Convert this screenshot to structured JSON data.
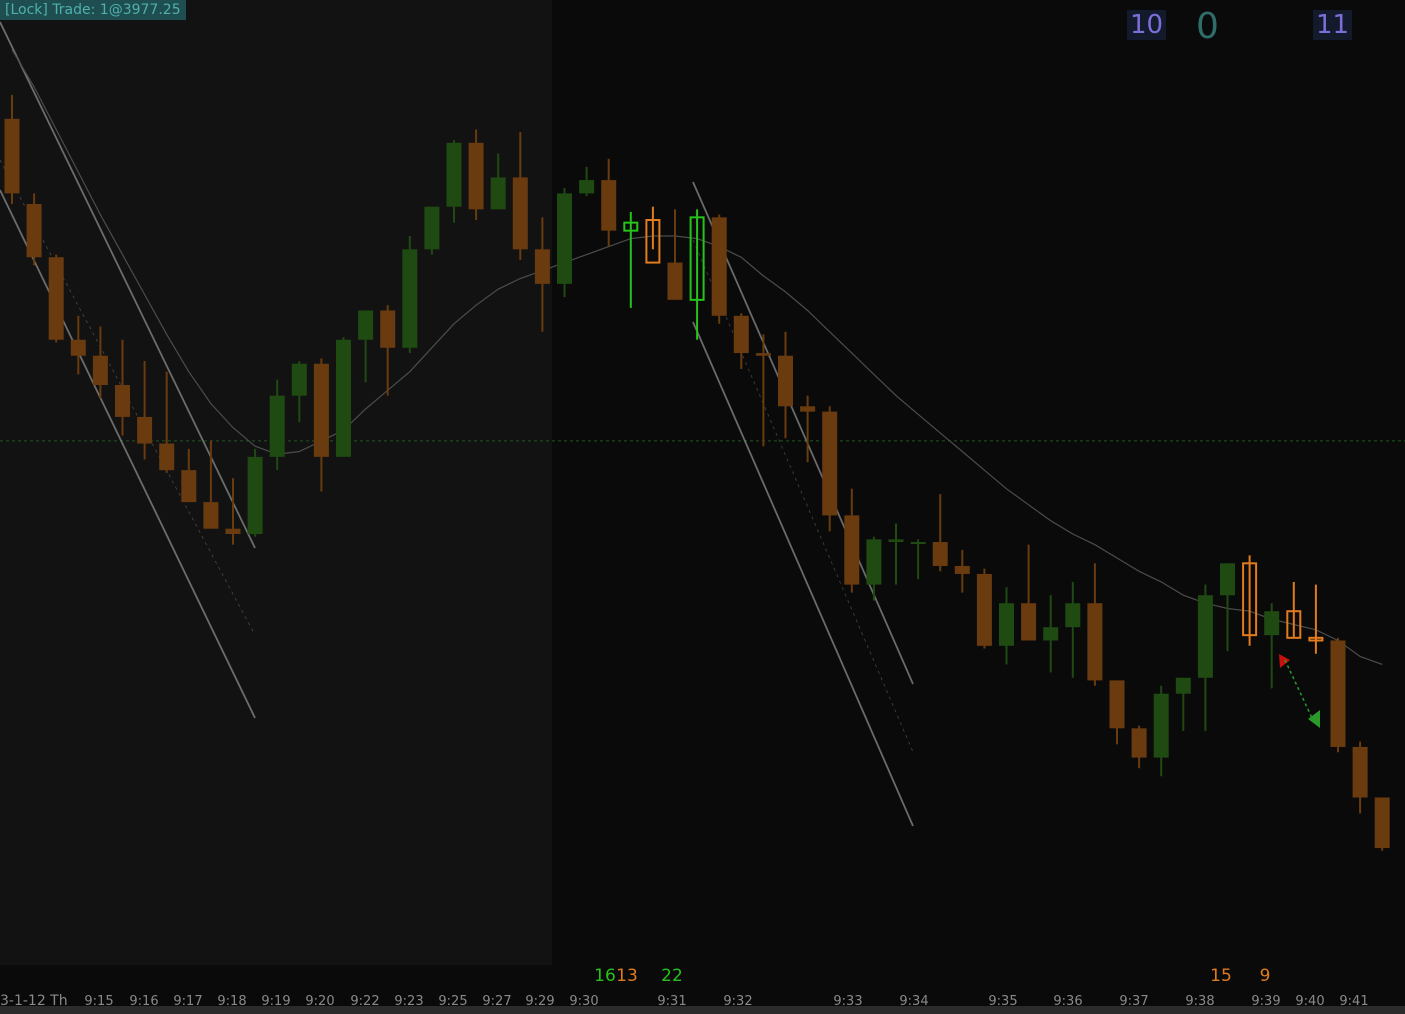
{
  "lock_badge": "[Lock] Trade: 1@3977.25",
  "counters": {
    "left": "10",
    "middle": "0",
    "right": "11"
  },
  "date_label": "3-1-12 Th",
  "colors": {
    "background": "#0a0a0a",
    "shaded_region": "#121212",
    "up_candle": "#1f4a12",
    "down_candle": "#6a3b0f",
    "highlight_down": "#e07b1f",
    "highlight_up": "#27c21a",
    "channel_line": "#8a8a8a",
    "moving_average": "#4c4c4c",
    "price_line": "#1e5a1e"
  },
  "chart_data": {
    "type": "candlestick",
    "title": "",
    "current_price": 3977.25,
    "time_labels": [
      "9:15",
      "9:16",
      "9:17",
      "9:18",
      "9:19",
      "9:20",
      "9:22",
      "9:23",
      "9:25",
      "9:27",
      "9:29",
      "9:30",
      "9:31",
      "9:32",
      "9:33",
      "9:34",
      "9:35",
      "9:36",
      "9:37",
      "9:38",
      "9:39",
      "9:40",
      "9:41"
    ],
    "volume_markers": [
      {
        "label": "16",
        "color": "#27c21a"
      },
      {
        "label": "13",
        "color": "#e07b1f"
      },
      {
        "label": "22",
        "color": "#27c21a"
      },
      {
        "label": "15",
        "color": "#e07b1f"
      },
      {
        "label": "9",
        "color": "#e07b1f"
      }
    ],
    "candles": [
      {
        "o": 3983.3,
        "h": 3983.75,
        "l": 3981.7,
        "c": 3981.9,
        "dir": "down"
      },
      {
        "o": 3981.7,
        "h": 3981.9,
        "l": 3980.55,
        "c": 3980.7,
        "dir": "down"
      },
      {
        "o": 3980.7,
        "h": 3980.75,
        "l": 3979.1,
        "c": 3979.15,
        "dir": "down"
      },
      {
        "o": 3979.15,
        "h": 3979.6,
        "l": 3978.5,
        "c": 3978.85,
        "dir": "down"
      },
      {
        "o": 3978.85,
        "h": 3979.4,
        "l": 3978.05,
        "c": 3978.3,
        "dir": "down"
      },
      {
        "o": 3978.3,
        "h": 3979.15,
        "l": 3977.35,
        "c": 3977.7,
        "dir": "down"
      },
      {
        "o": 3977.7,
        "h": 3978.75,
        "l": 3976.9,
        "c": 3977.2,
        "dir": "down"
      },
      {
        "o": 3977.2,
        "h": 3978.55,
        "l": 3976.65,
        "c": 3976.7,
        "dir": "down"
      },
      {
        "o": 3976.7,
        "h": 3977.1,
        "l": 3976.1,
        "c": 3976.1,
        "dir": "down"
      },
      {
        "o": 3976.1,
        "h": 3977.25,
        "l": 3975.8,
        "c": 3975.6,
        "dir": "down"
      },
      {
        "o": 3975.6,
        "h": 3976.55,
        "l": 3975.3,
        "c": 3975.5,
        "dir": "down"
      },
      {
        "o": 3975.5,
        "h": 3977.1,
        "l": 3975.45,
        "c": 3976.95,
        "dir": "up"
      },
      {
        "o": 3976.95,
        "h": 3978.4,
        "l": 3976.7,
        "c": 3978.1,
        "dir": "up"
      },
      {
        "o": 3978.1,
        "h": 3978.75,
        "l": 3977.6,
        "c": 3978.7,
        "dir": "up"
      },
      {
        "o": 3978.7,
        "h": 3978.8,
        "l": 3976.3,
        "c": 3976.95,
        "dir": "down"
      },
      {
        "o": 3976.95,
        "h": 3979.2,
        "l": 3976.95,
        "c": 3979.15,
        "dir": "up"
      },
      {
        "o": 3979.15,
        "h": 3979.55,
        "l": 3978.35,
        "c": 3979.7,
        "dir": "up"
      },
      {
        "o": 3979.7,
        "h": 3979.8,
        "l": 3978.1,
        "c": 3979.0,
        "dir": "down"
      },
      {
        "o": 3979.0,
        "h": 3981.1,
        "l": 3978.9,
        "c": 3980.85,
        "dir": "up"
      },
      {
        "o": 3980.85,
        "h": 3981.55,
        "l": 3980.75,
        "c": 3981.65,
        "dir": "up"
      },
      {
        "o": 3981.65,
        "h": 3982.9,
        "l": 3981.35,
        "c": 3982.85,
        "dir": "up"
      },
      {
        "o": 3982.85,
        "h": 3983.1,
        "l": 3981.4,
        "c": 3981.6,
        "dir": "down"
      },
      {
        "o": 3981.6,
        "h": 3982.65,
        "l": 3981.85,
        "c": 3982.2,
        "dir": "up"
      },
      {
        "o": 3982.2,
        "h": 3983.05,
        "l": 3980.65,
        "c": 3980.85,
        "dir": "down"
      },
      {
        "o": 3980.85,
        "h": 3981.45,
        "l": 3979.3,
        "c": 3980.2,
        "dir": "down"
      },
      {
        "o": 3980.2,
        "h": 3982.0,
        "l": 3979.95,
        "c": 3981.9,
        "dir": "up"
      },
      {
        "o": 3981.9,
        "h": 3982.4,
        "l": 3981.85,
        "c": 3982.15,
        "dir": "up"
      },
      {
        "o": 3982.15,
        "h": 3982.55,
        "l": 3980.9,
        "c": 3981.2,
        "dir": "down"
      },
      {
        "o": 3981.2,
        "h": 3981.55,
        "l": 3979.75,
        "c": 3981.35,
        "dir": "up",
        "hl": true
      },
      {
        "o": 3981.4,
        "h": 3981.65,
        "l": 3980.85,
        "c": 3980.6,
        "dir": "down",
        "hl": true
      },
      {
        "o": 3980.6,
        "h": 3981.6,
        "l": 3980.05,
        "c": 3979.9,
        "dir": "down"
      },
      {
        "o": 3979.9,
        "h": 3981.6,
        "l": 3979.15,
        "c": 3981.45,
        "dir": "up",
        "hl": true
      },
      {
        "o": 3981.45,
        "h": 3981.5,
        "l": 3979.45,
        "c": 3979.6,
        "dir": "down"
      },
      {
        "o": 3979.6,
        "h": 3979.65,
        "l": 3978.6,
        "c": 3978.9,
        "dir": "down"
      },
      {
        "o": 3978.9,
        "h": 3979.25,
        "l": 3977.15,
        "c": 3978.85,
        "dir": "down"
      },
      {
        "o": 3978.85,
        "h": 3979.3,
        "l": 3977.3,
        "c": 3977.9,
        "dir": "down"
      },
      {
        "o": 3977.9,
        "h": 3978.1,
        "l": 3976.85,
        "c": 3977.8,
        "dir": "down"
      },
      {
        "o": 3977.8,
        "h": 3977.9,
        "l": 3975.55,
        "c": 3975.85,
        "dir": "down"
      },
      {
        "o": 3975.85,
        "h": 3976.35,
        "l": 3974.4,
        "c": 3974.55,
        "dir": "down"
      },
      {
        "o": 3974.55,
        "h": 3975.45,
        "l": 3974.25,
        "c": 3975.4,
        "dir": "up"
      },
      {
        "o": 3975.4,
        "h": 3975.7,
        "l": 3974.55,
        "c": 3975.35,
        "dir": "up"
      },
      {
        "o": 3975.35,
        "h": 3975.4,
        "l": 3974.65,
        "c": 3975.35,
        "dir": "up"
      },
      {
        "o": 3975.35,
        "h": 3976.25,
        "l": 3974.8,
        "c": 3974.9,
        "dir": "down"
      },
      {
        "o": 3974.9,
        "h": 3975.2,
        "l": 3974.4,
        "c": 3974.75,
        "dir": "down"
      },
      {
        "o": 3974.75,
        "h": 3974.85,
        "l": 3973.35,
        "c": 3973.4,
        "dir": "down"
      },
      {
        "o": 3973.4,
        "h": 3974.5,
        "l": 3973.05,
        "c": 3974.2,
        "dir": "up"
      },
      {
        "o": 3974.2,
        "h": 3975.3,
        "l": 3973.65,
        "c": 3973.5,
        "dir": "down"
      },
      {
        "o": 3973.5,
        "h": 3974.35,
        "l": 3972.9,
        "c": 3973.75,
        "dir": "up"
      },
      {
        "o": 3973.75,
        "h": 3974.6,
        "l": 3972.8,
        "c": 3974.2,
        "dir": "up"
      },
      {
        "o": 3974.2,
        "h": 3974.95,
        "l": 3972.65,
        "c": 3972.75,
        "dir": "down"
      },
      {
        "o": 3972.75,
        "h": 3972.75,
        "l": 3971.55,
        "c": 3971.85,
        "dir": "down"
      },
      {
        "o": 3971.85,
        "h": 3971.9,
        "l": 3971.1,
        "c": 3971.3,
        "dir": "down"
      },
      {
        "o": 3971.3,
        "h": 3972.65,
        "l": 3970.95,
        "c": 3972.5,
        "dir": "up"
      },
      {
        "o": 3972.5,
        "h": 3972.8,
        "l": 3971.8,
        "c": 3972.8,
        "dir": "up"
      },
      {
        "o": 3972.8,
        "h": 3974.55,
        "l": 3971.8,
        "c": 3974.35,
        "dir": "up"
      },
      {
        "o": 3974.35,
        "h": 3974.95,
        "l": 3973.3,
        "c": 3974.95,
        "dir": "up"
      },
      {
        "o": 3974.95,
        "h": 3975.1,
        "l": 3973.4,
        "c": 3973.6,
        "dir": "down",
        "hl": true
      },
      {
        "o": 3973.6,
        "h": 3974.2,
        "l": 3972.6,
        "c": 3974.05,
        "dir": "up"
      },
      {
        "o": 3974.05,
        "h": 3974.6,
        "l": 3973.55,
        "c": 3973.55,
        "dir": "down",
        "hl": true
      },
      {
        "o": 3973.55,
        "h": 3974.55,
        "l": 3973.25,
        "c": 3973.5,
        "dir": "down",
        "hl": true
      },
      {
        "o": 3973.5,
        "h": 3973.55,
        "l": 3971.4,
        "c": 3971.5,
        "dir": "down"
      },
      {
        "o": 3971.5,
        "h": 3971.6,
        "l": 3970.25,
        "c": 3970.55,
        "dir": "down"
      },
      {
        "o": 3970.55,
        "h": 3970.55,
        "l": 3969.55,
        "c": 3969.6,
        "dir": "down"
      }
    ],
    "moving_average": [
      3984.6,
      3983.9,
      3983.1,
      3982.3,
      3981.5,
      3980.75,
      3980.0,
      3979.25,
      3978.55,
      3977.95,
      3977.5,
      3977.15,
      3977.0,
      3977.05,
      3977.25,
      3977.45,
      3977.85,
      3978.2,
      3978.55,
      3979.0,
      3979.45,
      3979.8,
      3980.1,
      3980.3,
      3980.45,
      3980.6,
      3980.75,
      3980.9,
      3981.05,
      3981.1,
      3981.1,
      3981.05,
      3980.9,
      3980.7,
      3980.35,
      3980.05,
      3979.7,
      3979.3,
      3978.9,
      3978.5,
      3978.1,
      3977.75,
      3977.4,
      3977.05,
      3976.7,
      3976.35,
      3976.05,
      3975.75,
      3975.5,
      3975.3,
      3975.05,
      3974.8,
      3974.6,
      3974.35,
      3974.2,
      3974.1,
      3974.05,
      3973.9,
      3973.8,
      3973.7,
      3973.5,
      3973.2,
      3973.05
    ]
  }
}
